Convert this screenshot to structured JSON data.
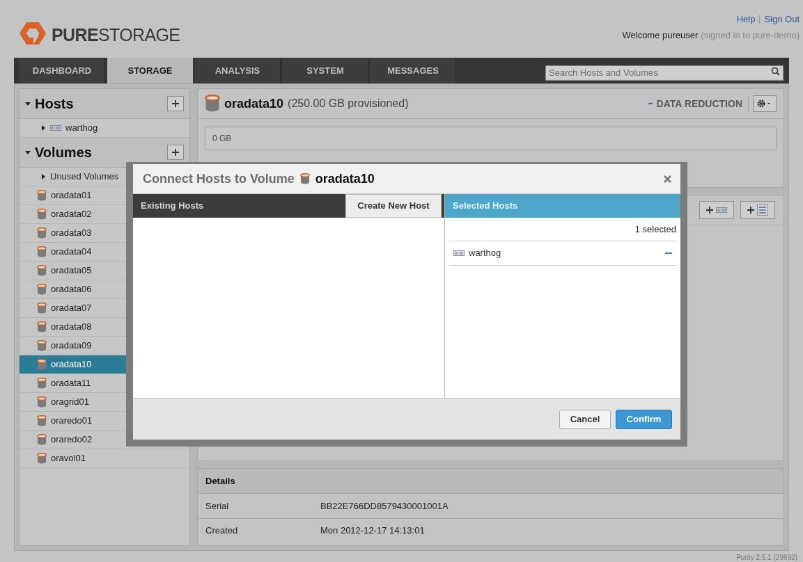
{
  "header": {
    "logo": {
      "strong": "PURE",
      "light": "STORAGE"
    },
    "links": [
      "Help",
      "Sign Out"
    ],
    "welcome": "Welcome pureuser",
    "signed_in": "(signed in to pure-demo)"
  },
  "nav": {
    "tabs": [
      {
        "label": "DASHBOARD",
        "selected": false
      },
      {
        "label": "STORAGE",
        "selected": true
      },
      {
        "label": "ANALYSIS",
        "selected": false
      },
      {
        "label": "SYSTEM",
        "selected": false
      },
      {
        "label": "MESSAGES",
        "selected": false
      }
    ],
    "search": {
      "placeholder": "Search Hosts and Volumes"
    }
  },
  "sidebar": {
    "sections": [
      {
        "title": "Hosts",
        "expanded": true,
        "items": [
          {
            "label": "warthog",
            "kind": "host",
            "selected": false
          }
        ]
      },
      {
        "title": "Volumes",
        "expanded": true,
        "items": [
          {
            "label": "Unused Volumes",
            "kind": "group",
            "selected": false
          },
          {
            "label": "oradata01",
            "kind": "volume",
            "selected": false
          },
          {
            "label": "oradata02",
            "kind": "volume",
            "selected": false
          },
          {
            "label": "oradata03",
            "kind": "volume",
            "selected": false
          },
          {
            "label": "oradata04",
            "kind": "volume",
            "selected": false
          },
          {
            "label": "oradata05",
            "kind": "volume",
            "selected": false
          },
          {
            "label": "oradata06",
            "kind": "volume",
            "selected": false
          },
          {
            "label": "oradata07",
            "kind": "volume",
            "selected": false
          },
          {
            "label": "oradata08",
            "kind": "volume",
            "selected": false
          },
          {
            "label": "oradata09",
            "kind": "volume",
            "selected": false
          },
          {
            "label": "oradata10",
            "kind": "volume",
            "selected": true
          },
          {
            "label": "oradata11",
            "kind": "volume",
            "selected": false
          },
          {
            "label": "oragrid01",
            "kind": "volume",
            "selected": false
          },
          {
            "label": "oraredo01",
            "kind": "volume",
            "selected": false
          },
          {
            "label": "oraredo02",
            "kind": "volume",
            "selected": false
          },
          {
            "label": "oravol01",
            "kind": "volume",
            "selected": false
          }
        ]
      }
    ]
  },
  "volume": {
    "name": "oradata10",
    "provisioned": "(250.00 GB provisioned)",
    "data_reduction": "DATA REDUCTION",
    "capacity": "0 GB"
  },
  "details": {
    "title": "Details",
    "rows": [
      {
        "label": "Serial",
        "value": "BB22E766DD8579430001001A"
      },
      {
        "label": "Created",
        "value": "Mon 2012-12-17 14:13:01"
      }
    ]
  },
  "modal": {
    "title": "Connect Hosts to Volume",
    "volume": "oradata10",
    "existing_header": "Existing Hosts",
    "create_button": "Create New Host",
    "selected_header": "Selected Hosts",
    "count": "1 selected",
    "selected_hosts": [
      {
        "name": "warthog"
      }
    ],
    "buttons": {
      "cancel": "Cancel",
      "confirm": "Confirm"
    }
  },
  "version": "Purity 2.5.1 (29692)"
}
